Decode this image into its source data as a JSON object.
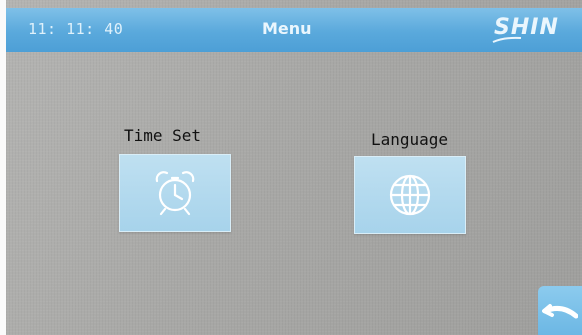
{
  "header": {
    "clock": "11: 11: 40",
    "title": "Menu",
    "logo_text": "SHIN"
  },
  "menu": {
    "items": [
      {
        "label": "Time Set",
        "icon": "alarm-clock-icon"
      },
      {
        "label": "Language",
        "icon": "globe-icon"
      }
    ],
    "back_icon": "back-arrow-icon"
  },
  "colors": {
    "header_blue": "#5aa9dc",
    "tile_blue": "#a7d3eb",
    "screen_gray": "#a6a6a4",
    "icon_white": "#ffffff"
  }
}
